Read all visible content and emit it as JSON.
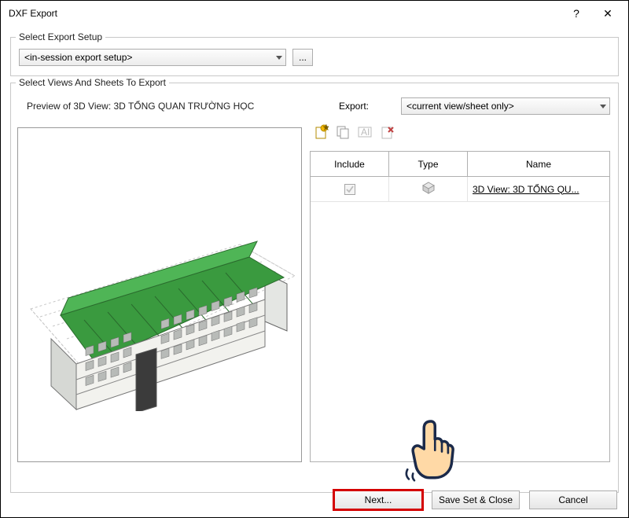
{
  "window": {
    "title": "DXF Export",
    "help": "?",
    "close": "✕"
  },
  "setup": {
    "legend": "Select Export Setup",
    "dropdown_value": "<in-session export setup>",
    "browse": "..."
  },
  "views": {
    "legend": "Select Views And Sheets To Export",
    "preview_label": "Preview of 3D View: 3D TỔNG QUAN TRƯỜNG HỌC",
    "export_label": "Export:",
    "export_dropdown": "<current view/sheet only>",
    "toolbar": {
      "new_set": "new-set-icon",
      "duplicate": "duplicate-icon",
      "rename": "rename-icon",
      "delete": "delete-icon"
    },
    "grid": {
      "headers": {
        "include": "Include",
        "type": "Type",
        "name": "Name"
      },
      "rows": [
        {
          "include": true,
          "type": "3d",
          "name": "3D View: 3D TỔNG QU..."
        }
      ]
    }
  },
  "buttons": {
    "next": "Next...",
    "save": "Save Set & Close",
    "cancel": "Cancel"
  }
}
